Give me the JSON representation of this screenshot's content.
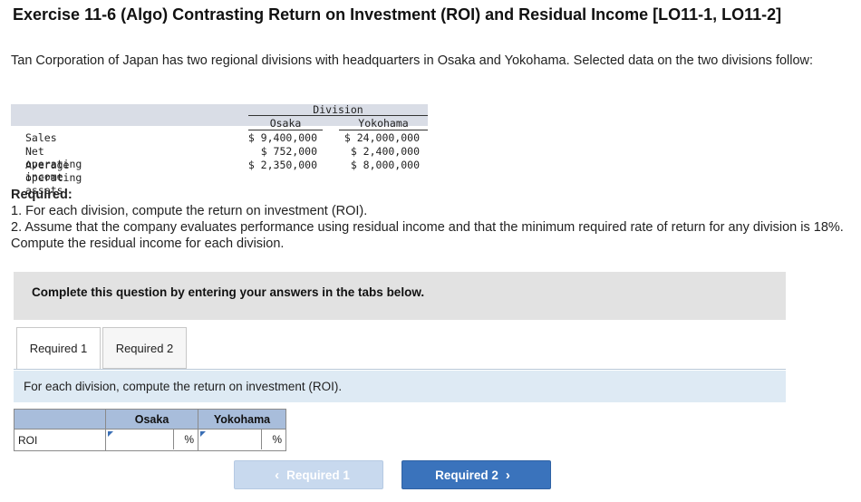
{
  "page": {
    "title": "Exercise 11-6 (Algo) Contrasting Return on Investment (ROI) and Residual Income [LO11-1, LO11-2]",
    "intro": "Tan Corporation of Japan has two regional divisions with headquarters in Osaka and Yokohama. Selected data on the two divisions follow:"
  },
  "data_table": {
    "group_header": "Division",
    "columns": [
      "Osaka",
      "Yokohama"
    ],
    "rows": [
      {
        "label": "Sales",
        "osaka": "$ 9,400,000",
        "yokohama": "$ 24,000,000"
      },
      {
        "label": "Net operating income",
        "osaka": "$ 752,000",
        "yokohama": "$ 2,400,000"
      },
      {
        "label": "Average operating assets",
        "osaka": "$ 2,350,000",
        "yokohama": "$ 8,000,000"
      }
    ]
  },
  "required": {
    "heading": "Required:",
    "item1": "1. For each division, compute the return on investment (ROI).",
    "item2": "2. Assume that the company evaluates performance using residual income and that the minimum required rate of return for any division is 18%. Compute the residual income for each division."
  },
  "banner": {
    "text": "Complete this question by entering your answers in the tabs below."
  },
  "tabs": [
    {
      "label": "Required 1",
      "active": true
    },
    {
      "label": "Required 2",
      "active": false
    }
  ],
  "instruction": "For each division, compute the return on investment (ROI).",
  "answer_table": {
    "headers": [
      "Osaka",
      "Yokohama"
    ],
    "row_label": "ROI",
    "osaka_value": "",
    "yokohama_value": "",
    "unit": "%"
  },
  "nav": {
    "prev_label": "Required 1",
    "next_label": "Required 2",
    "prev_icon": "chevron-left-icon",
    "next_icon": "chevron-right-icon"
  },
  "colors": {
    "header_band": "#d9dde6",
    "banner": "#e2e2e2",
    "instruction_bg": "#deeaf4",
    "answer_header": "#a8bddb",
    "next_button": "#3a73bc",
    "prev_button_disabled": "#c8d9ee"
  }
}
